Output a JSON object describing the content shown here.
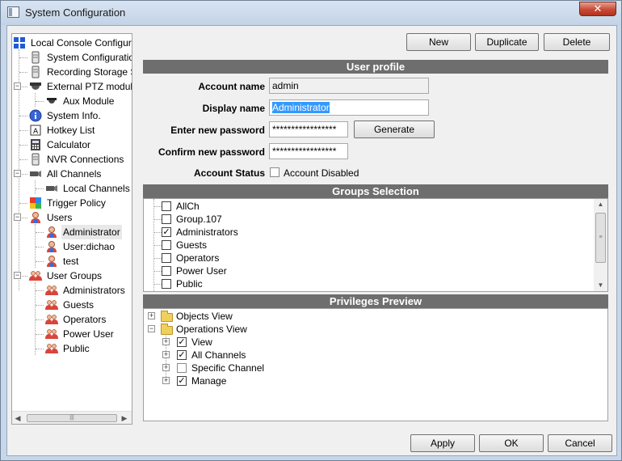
{
  "window": {
    "title": "System Configuration",
    "close_glyph": "✕"
  },
  "tree": {
    "items": [
      {
        "label": "Local Console Configuration",
        "icon": "windows-grid-icon"
      },
      {
        "label": "System Configuration",
        "icon": "server-icon"
      },
      {
        "label": "Recording Storage Se",
        "icon": "storage-icon"
      },
      {
        "label": "External PTZ module",
        "icon": "ptz-dome-icon"
      },
      {
        "label": "Aux Module",
        "icon": "dome-camera-icon"
      },
      {
        "label": "System Info.",
        "icon": "info-icon"
      },
      {
        "label": "Hotkey List",
        "icon": "hotkey-icon"
      },
      {
        "label": "Calculator",
        "icon": "calculator-icon"
      },
      {
        "label": "NVR Connections",
        "icon": "nvr-icon"
      },
      {
        "label": "All Channels",
        "icon": "camera-icon"
      },
      {
        "label": "Local Channels",
        "icon": "camera-icon"
      },
      {
        "label": "Trigger Policy",
        "icon": "trigger-icon"
      },
      {
        "label": "Users",
        "icon": "user-icon"
      },
      {
        "label": "Administrator",
        "icon": "user-icon"
      },
      {
        "label": "User:dichao",
        "icon": "user-icon"
      },
      {
        "label": "test",
        "icon": "user-icon"
      },
      {
        "label": "User Groups",
        "icon": "user-group-icon"
      },
      {
        "label": "Administrators",
        "icon": "user-group-icon"
      },
      {
        "label": "Guests",
        "icon": "user-group-icon"
      },
      {
        "label": "Operators",
        "icon": "user-group-icon"
      },
      {
        "label": "Power User",
        "icon": "user-group-icon"
      },
      {
        "label": "Public",
        "icon": "user-group-icon"
      }
    ],
    "selected": "Administrator",
    "scroll_left": "◀",
    "scroll_right": "▶",
    "scroll_grip": "|||"
  },
  "toolbar": {
    "new_label": "New",
    "duplicate_label": "Duplicate",
    "delete_label": "Delete"
  },
  "user_profile": {
    "header": "User profile",
    "account_name_label": "Account name",
    "account_name_value": "admin",
    "display_name_label": "Display name",
    "display_name_value": "Administrator",
    "new_password_label": "Enter new password",
    "new_password_value": "*****************",
    "confirm_password_label": "Confirm new password",
    "confirm_password_value": "*****************",
    "generate_label": "Generate",
    "account_status_label": "Account Status",
    "account_disabled_label": "Account Disabled",
    "account_disabled_checked": false
  },
  "groups_selection": {
    "header": "Groups Selection",
    "items": [
      {
        "label": "AllCh",
        "checked": false
      },
      {
        "label": "Group.107",
        "checked": false
      },
      {
        "label": "Administrators",
        "checked": true
      },
      {
        "label": "Guests",
        "checked": false
      },
      {
        "label": "Operators",
        "checked": false
      },
      {
        "label": "Power User",
        "checked": false
      },
      {
        "label": "Public",
        "checked": false
      }
    ],
    "scroll_up": "▲",
    "scroll_down": "▼",
    "scroll_grip": "≡"
  },
  "privileges_preview": {
    "header": "Privileges Preview",
    "items": [
      {
        "label": "Objects View",
        "expander": "+",
        "folder": true
      },
      {
        "label": "Operations View",
        "expander": "−",
        "folder": true
      },
      {
        "label": "View",
        "expander": "+",
        "checked": true
      },
      {
        "label": "All Channels",
        "expander": "+",
        "checked": true
      },
      {
        "label": "Specific Channel",
        "expander": "+",
        "checked": false
      },
      {
        "label": "Manage",
        "expander": "+",
        "checked": true
      }
    ]
  },
  "footer": {
    "apply_label": "Apply",
    "ok_label": "OK",
    "cancel_label": "Cancel"
  },
  "colors": {
    "section_header": "#6e6e6e",
    "selection": "#3399ff",
    "close_button": "#c84a34"
  }
}
